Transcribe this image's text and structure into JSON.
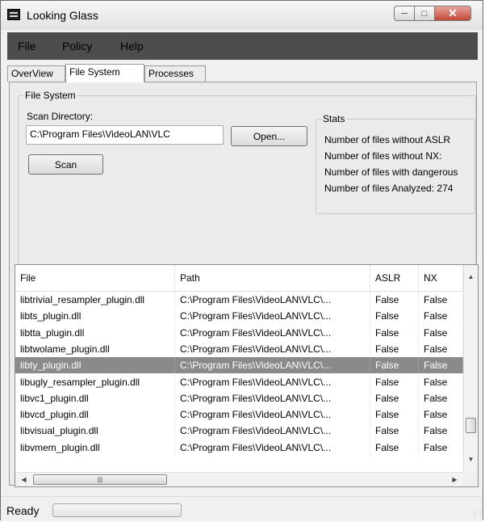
{
  "window": {
    "title": "Looking Glass"
  },
  "menu": [
    {
      "label": "File"
    },
    {
      "label": "Policy"
    },
    {
      "label": "Help"
    }
  ],
  "tabs": [
    {
      "label": "OverView",
      "active": false
    },
    {
      "label": "File System",
      "active": true
    },
    {
      "label": "Processes",
      "active": false
    }
  ],
  "filesystem": {
    "group_title": "File System",
    "scan_dir_label": "Scan Directory:",
    "scan_dir_value": "C:\\Program Files\\VideoLAN\\VLC",
    "open_label": "Open...",
    "scan_label": "Scan"
  },
  "stats": {
    "title": "Stats",
    "lines": [
      "Number of files without ASLR",
      "Number of files without NX:",
      "Number of files with dangerous",
      "Number of files Analyzed: 274"
    ]
  },
  "grid": {
    "columns": [
      "File",
      "Path",
      "ASLR",
      "NX"
    ],
    "rows": [
      [
        "libtrivial_resampler_plugin.dll",
        "C:\\Program Files\\VideoLAN\\VLC\\...",
        "False",
        "False"
      ],
      [
        "libts_plugin.dll",
        "C:\\Program Files\\VideoLAN\\VLC\\...",
        "False",
        "False"
      ],
      [
        "libtta_plugin.dll",
        "C:\\Program Files\\VideoLAN\\VLC\\...",
        "False",
        "False"
      ],
      [
        "libtwolame_plugin.dll",
        "C:\\Program Files\\VideoLAN\\VLC\\...",
        "False",
        "False"
      ],
      [
        "libty_plugin.dll",
        "C:\\Program Files\\VideoLAN\\VLC\\...",
        "False",
        "False"
      ],
      [
        "libugly_resampler_plugin.dll",
        "C:\\Program Files\\VideoLAN\\VLC\\...",
        "False",
        "False"
      ],
      [
        "libvc1_plugin.dll",
        "C:\\Program Files\\VideoLAN\\VLC\\...",
        "False",
        "False"
      ],
      [
        "libvcd_plugin.dll",
        "C:\\Program Files\\VideoLAN\\VLC\\...",
        "False",
        "False"
      ],
      [
        "libvisual_plugin.dll",
        "C:\\Program Files\\VideoLAN\\VLC\\...",
        "False",
        "False"
      ],
      [
        "libvmem_plugin.dll",
        "C:\\Program Files\\VideoLAN\\VLC\\...",
        "False",
        "False"
      ]
    ],
    "selected_row": 4
  },
  "status": {
    "text": "Ready",
    "progress": 0
  }
}
